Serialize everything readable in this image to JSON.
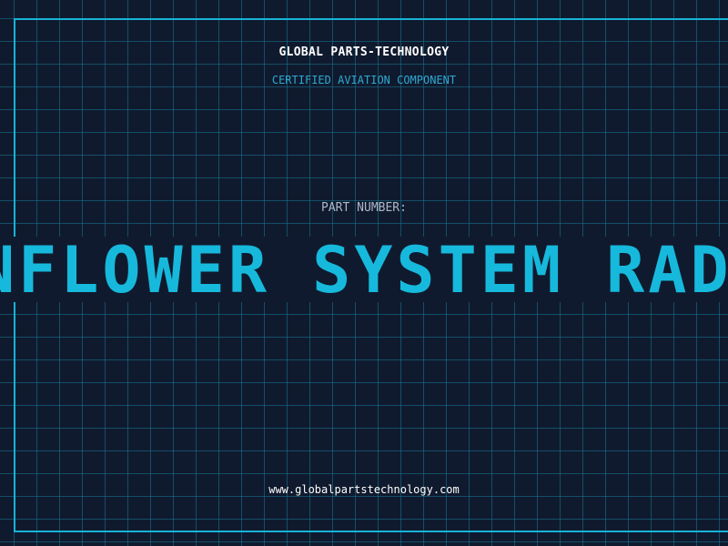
{
  "header": {
    "brand": "GLOBAL PARTS-TECHNOLOGY",
    "subtitle": "CERTIFIED AVIATION COMPONENT"
  },
  "part": {
    "label": "PART NUMBER:",
    "value": "NFLOWER SYSTEM RAD"
  },
  "footer": {
    "url": "www.globalpartstechnology.com"
  },
  "colors": {
    "background": "#101a2e",
    "grid": "#16789a",
    "accent": "#16b9dc",
    "text": "#ffffff",
    "muted": "#aeb8c8"
  }
}
